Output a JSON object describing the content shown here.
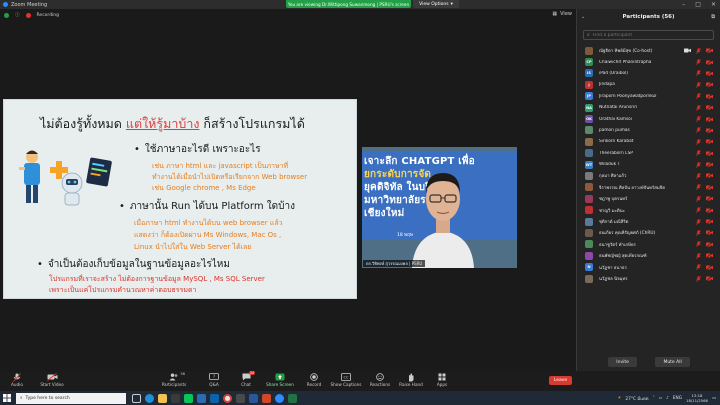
{
  "window": {
    "title": "Zoom Meeting",
    "sharing_text": "You are viewing Dr.Wittipong Suwanmong | PSRU's screen",
    "view_options": "View Options"
  },
  "status": {
    "recording": "Recording",
    "view_label": "View"
  },
  "slide": {
    "title_prefix": "ไม่ต้องรู้ทั้งหมด ",
    "title_highlight": "แต่ให้รู้มาบ้าง",
    "title_suffix": " ก็สร้างโปรแกรมได้",
    "b1": "ใช้ภาษาอะไรดี เพราะอะไร",
    "b1_sub1": "เช่น ภาษา html และ javascript เป็นภาษาที่",
    "b1_sub2": "ทำงานได้เมื่อนำไปเปิดหรือเรียกจาก Web browser",
    "b1_sub3": "เช่น Google chrome , Ms Edge",
    "b2": "ภาษานั้น Run ได้บน Platform ใดบ้าง",
    "b2_sub1": "เมื่อภาษา html ทำงานได้บน web browser แล้ว",
    "b2_sub2": "แสดงว่า ก็ต้องเปิดผ่าน Ms Windows, Mac Os ,",
    "b2_sub3": "Linux นำไปใส่ใน Web Server ได้เลย",
    "b3": "จำเป็นต้องเก็บข้อมูลในฐานข้อมูลอะไรไหม",
    "b3_sub1": "โปรแกรมที่เราจะสร้าง ไม่ต้องการฐานข้อมูล MySQL , Ms SQL Server",
    "b3_sub2": "เพราะเป็นแค่โปรแกรมคำนวณหาค่าตอบธรรมดา"
  },
  "speaker": {
    "banner_line1": "เจาะลึก CHATGPT เพื่อ",
    "banner_line2": "ยกระดับการจัด",
    "banner_line3": "ยุคดิจิทัล ในบริ",
    "banner_line4": "มหาวิทยาลัยรา",
    "banner_line5": "เชียงใหม่",
    "date": "18 พฤษ",
    "name_tag": "ดร.วิทิพงษ์ สุวรรณมงคล | PSRU"
  },
  "panel": {
    "title": "Participants (56)",
    "search_placeholder": "Find a participant",
    "invite": "Invite",
    "mute_all": "Mute All",
    "participants": [
      {
        "initials": "",
        "color": "#7b5b3a",
        "name": "ณัฐธิดา ทิพย์มีสุข (Co-host)",
        "cam": true
      },
      {
        "initials": "CP",
        "color": "#2e8b57",
        "name": "Chaiwichit Phanintrapha",
        "cam": false
      },
      {
        "initials": "IS",
        "color": "#2a6bb5",
        "name": "iPad (Uraibol)",
        "cam": false
      },
      {
        "initials": "J",
        "color": "#c03030",
        "name": "Jindapa",
        "cam": false
      },
      {
        "initials": "JP",
        "color": "#3a7bd5",
        "name": "Jiraporn Poonyawatpornkul",
        "cam": false
      },
      {
        "initials": "NA",
        "color": "#2e9e6e",
        "name": "Nutnatai Arunsriri",
        "cam": false
      },
      {
        "initials": "OK",
        "color": "#6b4fa6",
        "name": "Orathai Kamsoi",
        "cam": false
      },
      {
        "initials": "",
        "color": "#5a8a6a",
        "name": "pamon pumas",
        "cam": false
      },
      {
        "initials": "",
        "color": "#8a6b4a",
        "name": "Sirikorn Karabat",
        "cam": false
      },
      {
        "initials": "",
        "color": "#4a6a8a",
        "name": "Theeraborn LSP",
        "cam": false
      },
      {
        "initials": "WT",
        "color": "#3d7bbf",
        "name": "Wiladuk T",
        "cam": false
      },
      {
        "initials": "",
        "color": "#7a7a7a",
        "name": "กุลมา ศิลาแก้ว",
        "cam": false
      },
      {
        "initials": "",
        "color": "#8a5a3a",
        "name": "จิราพรรณ ศิลปัน ยาวงษ์จันทร์สมจิต",
        "cam": false
      },
      {
        "initials": "",
        "color": "#9a3a5a",
        "name": "ชฎาพู บุตรนทร์",
        "cam": false
      },
      {
        "initials": "",
        "color": "#c03030",
        "name": "ชาญวิ มะตินะ",
        "cam": false
      },
      {
        "initials": "",
        "color": "#5a7a9a",
        "name": "ชุติกาต์ มณีสิริต",
        "cam": false
      },
      {
        "initials": "",
        "color": "#6a5a4a",
        "name": "ธนเกียร คุณหิรัญยศภ์ (ChRU)",
        "cam": false
      },
      {
        "initials": "",
        "color": "#4a8a5a",
        "name": "ธนาชูวัตร์ คำเกษียร",
        "cam": false
      },
      {
        "initials": "",
        "color": "#8a4aa6",
        "name": "ธนพัชญ์ชญ์ สุดเทียรกณฑ์",
        "cam": false
      },
      {
        "initials": "N",
        "color": "#3a7bd5",
        "name": "นวัฏชา ธนาธร",
        "cam": false
      },
      {
        "initials": "",
        "color": "#7a6a5a",
        "name": "นวัฏชล นิจมุทร",
        "cam": false
      }
    ]
  },
  "toolbar": {
    "audio": "Audio",
    "start_video": "Start Video",
    "participants": "Participants",
    "participants_count": "56",
    "qa": "Q&A",
    "chat": "Chat",
    "chat_badge": "24",
    "share_screen": "Share Screen",
    "record": "Record",
    "show_captions": "Show Captions",
    "reactions": "Reactions",
    "raise_hand": "Raise Hand",
    "apps": "Apps",
    "leave": "Leave"
  },
  "taskbar": {
    "search_placeholder": "Type here to search",
    "weather": "27°C มีแดด",
    "lang": "ENG",
    "time": "13:18",
    "date": "18/11/2566"
  },
  "colors": {
    "accent_green": "#23a047",
    "leave_red": "#d63a30",
    "slide_orange": "#e67d1e",
    "slide_red": "#d9342b"
  }
}
